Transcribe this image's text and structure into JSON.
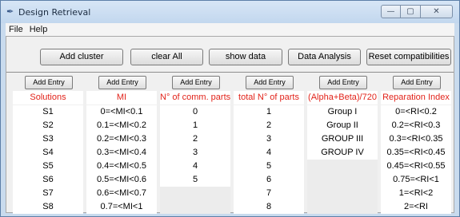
{
  "window": {
    "title": "Design Retrieval",
    "app_icon": "feather-icon",
    "caption": {
      "minimize": "—",
      "maximize": "▢",
      "close": "✕"
    }
  },
  "menu": [
    "File",
    "Help"
  ],
  "toolbar": {
    "add_cluster": "Add cluster",
    "clear_all": "clear All",
    "show_data": "show data",
    "data_analysis": "Data Analysis",
    "reset_compat": "Reset compatibilities"
  },
  "table": {
    "entry_label": "Add Entry",
    "columns": [
      {
        "header": "Solutions",
        "cells": [
          "S1",
          "S2",
          "S3",
          "S4",
          "S5",
          "S6",
          "S7",
          "S8"
        ]
      },
      {
        "header": "MI",
        "cells": [
          "0=<MI<0.1",
          "0.1=<MI<0.2",
          "0.2=<MI<0.3",
          "0.3=<MI<0.4",
          "0.4=<MI<0.5",
          "0.5=<MI<0.6",
          "0.6=<MI<0.7",
          "0.7=<MI<1"
        ]
      },
      {
        "header": "N° of comm. parts",
        "cells": [
          "0",
          "1",
          "2",
          "3",
          "4",
          "5",
          "",
          ""
        ]
      },
      {
        "header": "total N° of parts",
        "cells": [
          "1",
          "2",
          "3",
          "4",
          "5",
          "6",
          "7",
          "8"
        ]
      },
      {
        "header": "(Alpha+Beta)/720",
        "cells": [
          "Group I",
          "Group II",
          "GROUP III",
          "GROUP IV",
          "",
          "",
          "",
          ""
        ]
      },
      {
        "header": "Reparation Index",
        "cells": [
          "0=<RI<0.2",
          "0.2=<RI<0.3",
          "0.3=<RI<0.35",
          "0.35=<RI<0.45",
          "0.45=<RI<0.55",
          "0.75=<RI<1",
          "1=<RI<2",
          "2=<RI"
        ]
      }
    ]
  },
  "colors": {
    "header_red": "#e2231a",
    "frame_blue": "#c9dbee"
  }
}
